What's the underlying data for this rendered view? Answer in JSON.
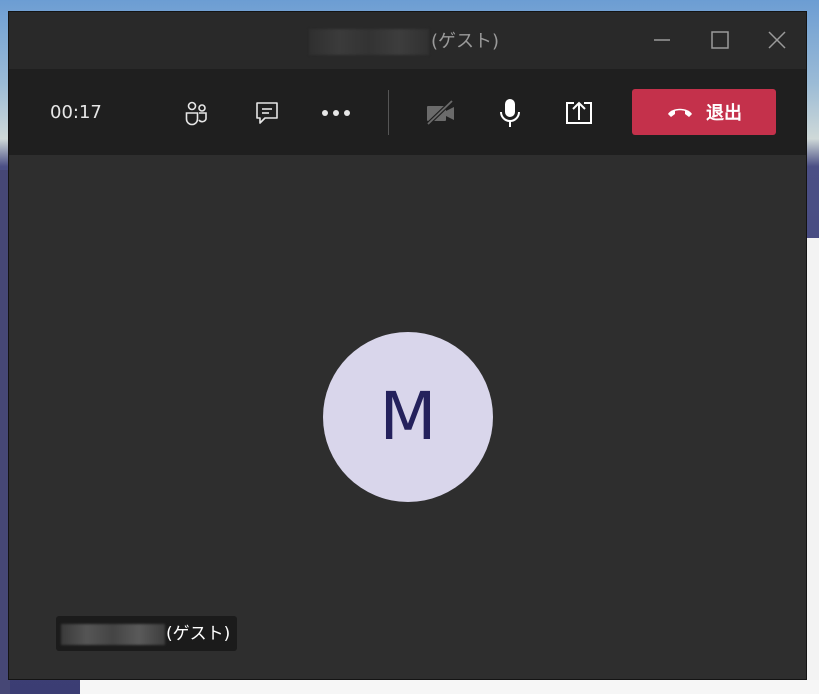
{
  "window": {
    "title_suffix": "(ゲスト)"
  },
  "toolbar": {
    "timer": "00:17",
    "leave_label": "退出"
  },
  "stage": {
    "avatar_initial": "M",
    "name_tag_suffix": "(ゲスト)"
  },
  "icons": {
    "minimize": "minimize-icon",
    "maximize": "maximize-icon",
    "close": "close-icon",
    "participants": "people-icon",
    "chat": "chat-icon",
    "more": "more-icon",
    "camera": "camera-off-icon",
    "mic": "microphone-icon",
    "share": "share-screen-icon",
    "hangup": "hang-up-icon"
  },
  "colors": {
    "leave_button": "#c4314b",
    "avatar_bg": "#d9d6eb",
    "avatar_text": "#24215c"
  }
}
